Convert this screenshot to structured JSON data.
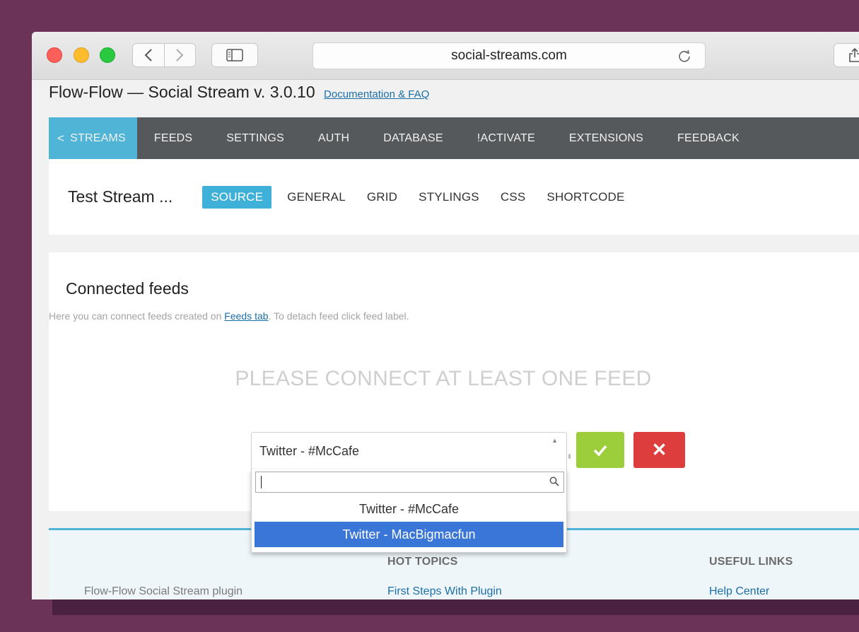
{
  "browser": {
    "url": "social-streams.com"
  },
  "page": {
    "title": "Flow-Flow — Social Stream v. 3.0.10",
    "doc_link": "Documentation & FAQ"
  },
  "main_nav": {
    "items": [
      {
        "label": "STREAMS",
        "active": true
      },
      {
        "label": "FEEDS"
      },
      {
        "label": "SETTINGS"
      },
      {
        "label": "AUTH"
      },
      {
        "label": "DATABASE"
      },
      {
        "label": "!ACTIVATE"
      },
      {
        "label": "EXTENSIONS"
      },
      {
        "label": "FEEDBACK"
      }
    ]
  },
  "stream": {
    "name": "Test Stream ...",
    "tabs": [
      {
        "label": "SOURCE",
        "active": true
      },
      {
        "label": "GENERAL"
      },
      {
        "label": "GRID"
      },
      {
        "label": "STYLINGS"
      },
      {
        "label": "CSS"
      },
      {
        "label": "SHORTCODE"
      }
    ]
  },
  "feeds": {
    "heading": "Connected feeds",
    "desc_before": "Here you can connect feeds created on ",
    "desc_link": "Feeds tab",
    "desc_after": ". To detach feed click feed label.",
    "empty_message": "PLEASE CONNECT AT LEAST ONE FEED"
  },
  "select": {
    "value": "Twitter - #McCafe",
    "search_value": "",
    "options": [
      {
        "label": "Twitter - #McCafe"
      },
      {
        "label": "Twitter - MacBigmacfun",
        "highlighted": true
      }
    ]
  },
  "buttons": {
    "confirm_icon": "check-icon",
    "cancel_icon": "close-icon",
    "cancel_glyph": "✕"
  },
  "footer": {
    "plugin_text": "Flow-Flow Social Stream plugin",
    "hot_topics_heading": "HOT TOPICS",
    "hot_topic_1": "First Steps With Plugin",
    "useful_links_heading": "USEFUL LINKS",
    "useful_link_1": "Help Center"
  },
  "colors": {
    "desktop_bg": "#6c3358",
    "nav_bg": "#56595c",
    "accent": "#4fb4d6",
    "confirm": "#9ccd3a",
    "cancel": "#dd3d3d",
    "highlight": "#3a75d8"
  }
}
